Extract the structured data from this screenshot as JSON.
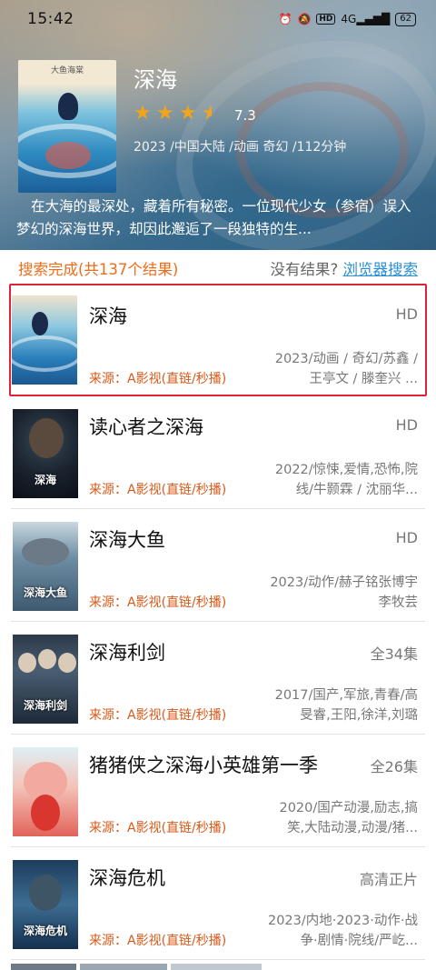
{
  "status": {
    "time": "15:42",
    "icons": [
      "alarm-icon",
      "mute-icon",
      "hd-icon",
      "signal-4g-icon"
    ],
    "hd": "HD",
    "net": "4G",
    "battery": "62"
  },
  "movie": {
    "title": "深海",
    "rating": "7.3",
    "stars": 3.5,
    "meta": "2023 /中国大陆 /动画 奇幻 /112分钟",
    "description": "在大海的最深处，藏着所有秘密。一位现代少女（参宿）误入梦幻的深海世界，却因此邂逅了一段独特的生...",
    "poster_caption": "大鱼海棠"
  },
  "search": {
    "done_text": "搜索完成(共137个结果)",
    "no_result_text": "没有结果?",
    "browser_link": "浏览器搜索"
  },
  "results": [
    {
      "name": "深海",
      "tag": "HD",
      "info": "2023/动画 / 奇幻/苏鑫 / 王亭文 / 滕奎兴 ...",
      "source": "来源：A影视(直链/秒播)",
      "thumb_caption": ""
    },
    {
      "name": "读心者之深海",
      "tag": "HD",
      "info": "2022/惊悚,爱情,恐怖,院线/牛颢霖 / 沈丽华...",
      "source": "来源：A影视(直链/秒播)",
      "thumb_caption": "深海"
    },
    {
      "name": "深海大鱼",
      "tag": "HD",
      "info": "2023/动作/赫子铭张博宇李牧芸",
      "source": "来源：A影视(直链/秒播)",
      "thumb_caption": "深海大鱼"
    },
    {
      "name": "深海利剑",
      "tag": "全34集",
      "info": "2017/国产,军旅,青春/高旻睿,王阳,徐洋,刘璐",
      "source": "来源：A影视(直链/秒播)",
      "thumb_caption": "深海利剑"
    },
    {
      "name": "猪猪侠之深海小英雄第一季",
      "tag": "全26集",
      "info": "2020/国产动漫,励志,搞笑,大陆动漫,动漫/猪...",
      "source": "来源：A影视(直链/秒播)",
      "thumb_caption": ""
    },
    {
      "name": "深海危机",
      "tag": "高清正片",
      "info": "2023/内地·2023·动作·战争·剧情·院线/严屹...",
      "source": "来源：A影视(直链/秒播)",
      "thumb_caption": "深海危机"
    }
  ]
}
